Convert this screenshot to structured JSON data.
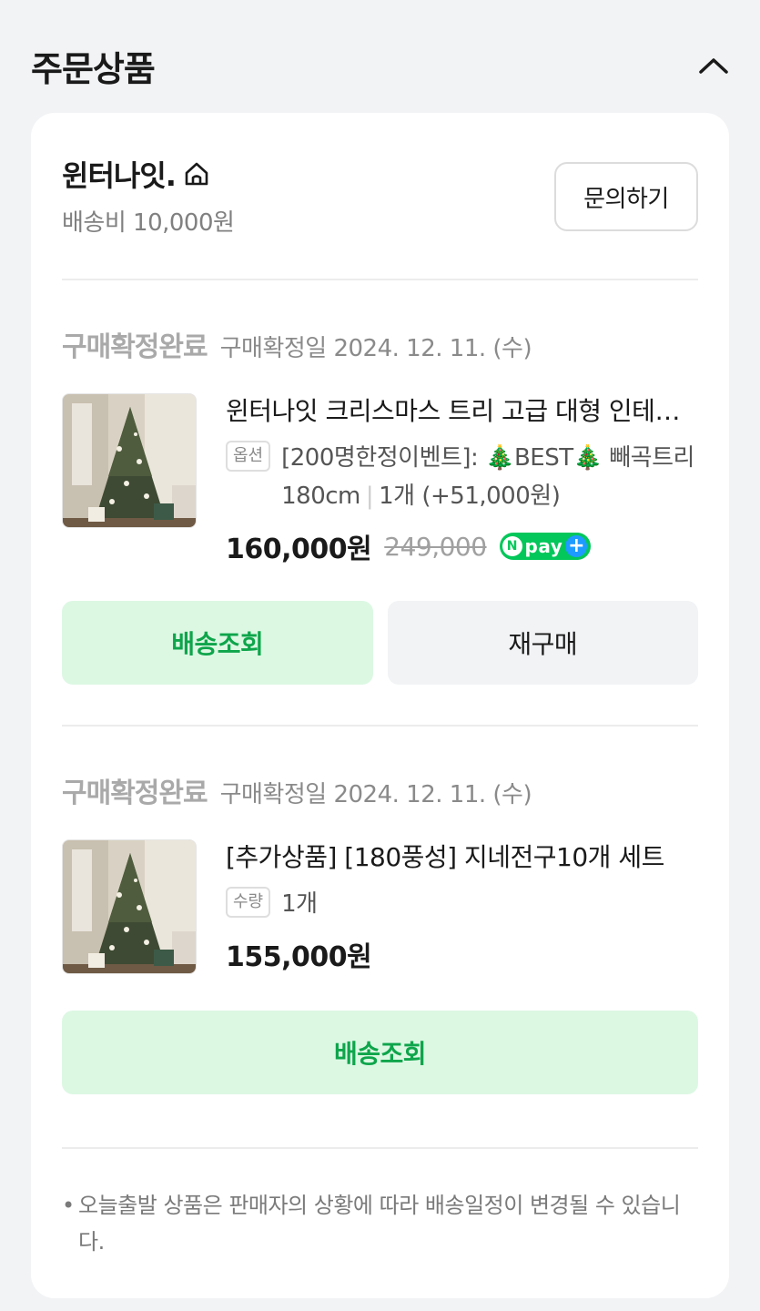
{
  "section": {
    "title": "주문상품"
  },
  "seller": {
    "name": "윈터나잇.",
    "shipping_fee": "배송비 10,000원",
    "inquiry_label": "문의하기"
  },
  "orders": [
    {
      "status": "구매확정완료",
      "confirm_date": "구매확정일 2024. 12. 11. (수)",
      "product_name": "윈터나잇 크리스마스 트리 고급 대형 인테리어 트리",
      "option_tag": "옵션",
      "option_text": "[200명한정이벤트]: 🎄BEST🎄 빼곡트리 180cm",
      "option_qty": "1개 (+51,000원)",
      "price": "160,000원",
      "original_price": "249,000",
      "npay_label": "pay",
      "track_label": "배송조회",
      "rebuy_label": "재구매"
    },
    {
      "status": "구매확정완료",
      "confirm_date": "구매확정일 2024. 12. 11. (수)",
      "product_name": "[추가상품] [180풍성] 지네전구10개 세트",
      "option_tag": "수량",
      "option_text": "1개",
      "price": "155,000원",
      "track_label": "배송조회"
    }
  ],
  "notice": {
    "bullet": "•",
    "text": "오늘출발 상품은 판매자의 상황에 따라 배송일정이 변경될 수 있습니다."
  },
  "colors": {
    "accent_green": "#0ea54b",
    "button_green_bg": "#dcf8e3",
    "npay_green": "#03c75a",
    "npay_plus_blue": "#1e9bff"
  }
}
